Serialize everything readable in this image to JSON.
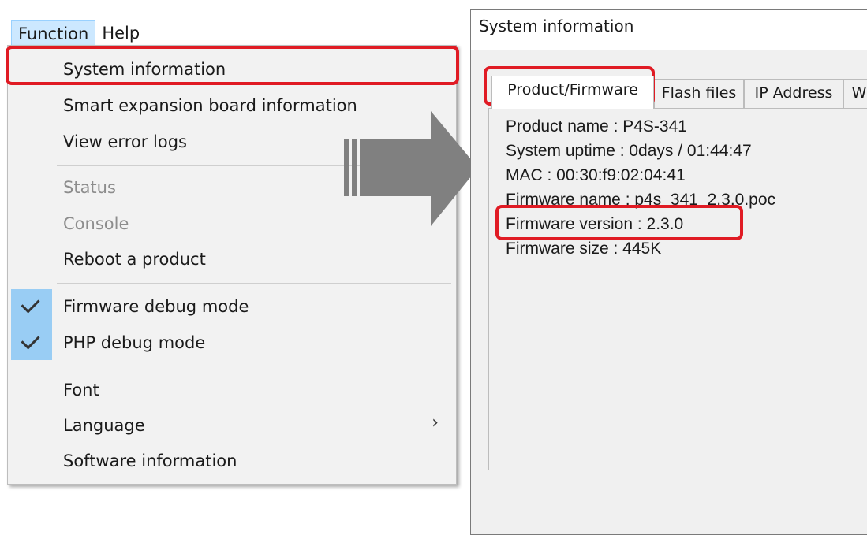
{
  "menubar": {
    "function_label": "Function",
    "help_label": "Help"
  },
  "menu": {
    "items": [
      {
        "label": "System information"
      },
      {
        "label": "Smart expansion board information"
      },
      {
        "label": "View error logs"
      },
      {
        "label": "Status",
        "disabled": true
      },
      {
        "label": "Console",
        "disabled": true
      },
      {
        "label": "Reboot a product"
      },
      {
        "label": "Firmware debug mode",
        "checked": true
      },
      {
        "label": "PHP debug mode",
        "checked": true
      },
      {
        "label": "Font"
      },
      {
        "label": "Language",
        "submenu": true
      },
      {
        "label": "Software information"
      }
    ],
    "submenu_glyph": "›"
  },
  "dialog": {
    "title": "System information",
    "tabs": [
      "Product/Firmware",
      "Flash files",
      "IP Address",
      "W"
    ],
    "active_tab": "Product/Firmware",
    "info": {
      "product_name": "Product name : P4S-341",
      "system_uptime": "System uptime : 0days / 01:44:47",
      "mac": "MAC : 00:30:f9:02:04:41",
      "firmware_name": "Firmware name : p4s_341_2.3.0.poc",
      "firmware_version": "Firmware version : 2.3.0",
      "firmware_size": "Firmware size : 445K"
    }
  },
  "colors": {
    "highlight_box": "#e01b24",
    "check_column": "#99cdf4",
    "arrow": "#808080"
  }
}
